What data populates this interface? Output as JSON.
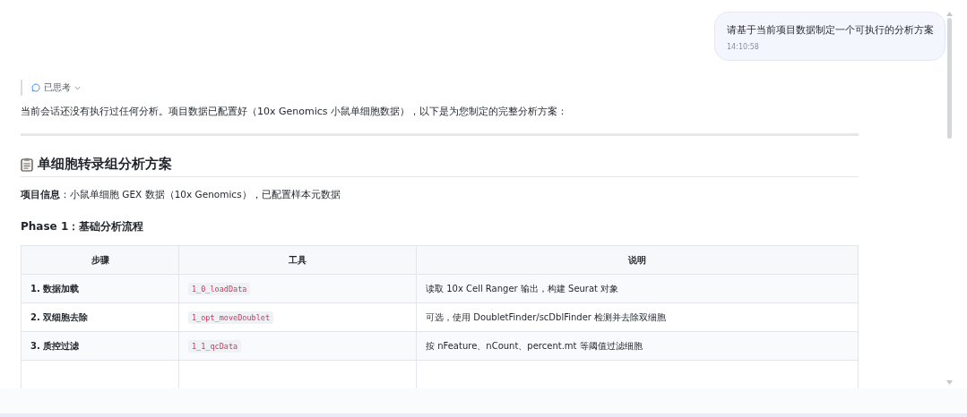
{
  "user_message": {
    "text": "请基于当前项目数据制定一个可执行的分析方案",
    "time": "14:10:58"
  },
  "thinking": {
    "label": "已思考",
    "expanded": false
  },
  "intro": "当前会话还没有执行过任何分析。项目数据已配置好（10x Genomics 小鼠单细胞数据），以下是为您制定的完整分析方案：",
  "heading": "单细胞转录组分析方案",
  "project_info": "**项目信息**：小鼠单细胞 GEX 数据（10x Genomics），已配置样本元数据",
  "phase_title": "Phase 1：基础分析流程",
  "table": {
    "columns": [
      "步骤",
      "工具",
      "说明"
    ],
    "rows": [
      {
        "step": "1. 数据加载",
        "tool": "1_0_loadData",
        "note": "读取 10x Cell Ranger 输出，构建 Seurat 对象"
      },
      {
        "step": "2. 双细胞去除",
        "tool": "1_opt_moveDoublet",
        "note": "可选，使用 DoubletFinder/scDblFinder 检测并去除双细胞"
      },
      {
        "step": "3. 质控过滤",
        "tool": "1_1_qcData",
        "note": "按 nFeature、nCount、percent.mt 等阈值过滤细胞"
      }
    ]
  }
}
